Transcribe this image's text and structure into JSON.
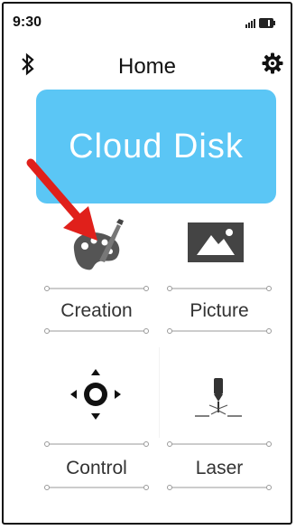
{
  "status": {
    "time": "9:30"
  },
  "header": {
    "title": "Home"
  },
  "cloud": {
    "label": "Cloud Disk"
  },
  "tiles": [
    {
      "label": "Creation",
      "icon": "palette-icon"
    },
    {
      "label": "Picture",
      "icon": "picture-icon"
    },
    {
      "label": "Control",
      "icon": "directional-pad-icon"
    },
    {
      "label": "Laser",
      "icon": "laser-icon"
    }
  ],
  "annotation": {
    "icon": "red-arrow-icon",
    "color": "#e0201b"
  },
  "colors": {
    "card": "#5bc6f5",
    "text": "#333333"
  }
}
